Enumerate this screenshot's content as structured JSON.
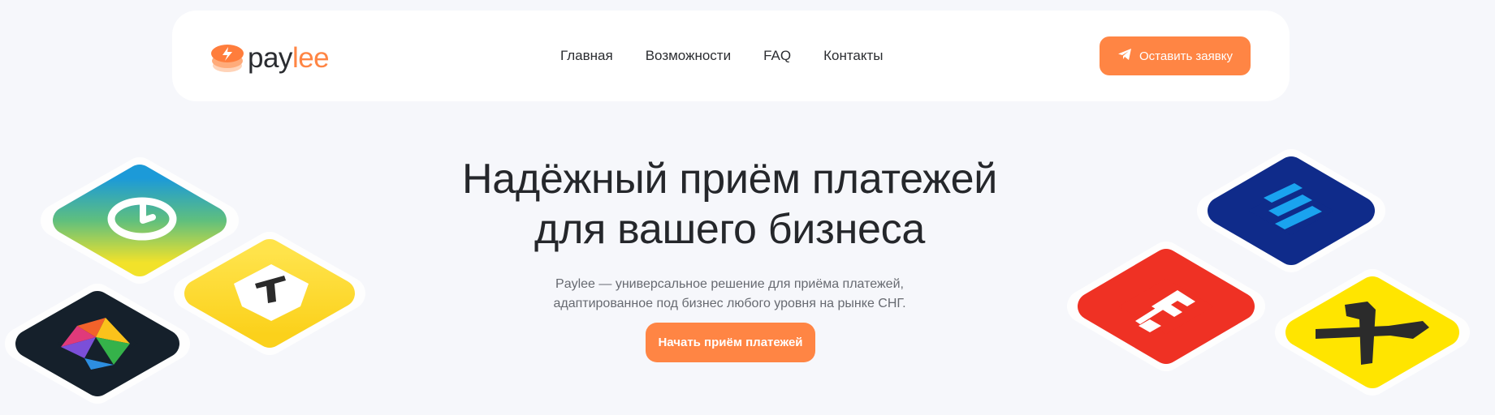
{
  "header": {
    "logo": {
      "part1": "pay",
      "part2": "lee"
    },
    "nav": [
      "Главная",
      "Возможности",
      "FAQ",
      "Контакты"
    ],
    "cta_label": "Оставить заявку"
  },
  "hero": {
    "title_line1": "Надёжный приём платежей",
    "title_line2": "для вашего бизнеса",
    "subtitle_line1": "Paylee — универсальное решение для приёма платежей,",
    "subtitle_line2": "адаптированное под бизнес любого уровня на рынке СНГ.",
    "cta_label": "Начать приём платежей"
  },
  "tiles": [
    {
      "name": "sbp-tile",
      "icon": "check-circle-icon"
    },
    {
      "name": "tbank-tile",
      "icon": "t-shield-icon"
    },
    {
      "name": "multicolor-tile",
      "icon": "colorful-triangles-icon"
    },
    {
      "name": "vtb-tile",
      "icon": "stripes-icon"
    },
    {
      "name": "alfa-tile",
      "icon": "a-letter-icon"
    },
    {
      "name": "yellow-tile",
      "icon": "t-hammer-icon"
    }
  ],
  "colors": {
    "accent": "#ff8544",
    "background": "#f6f7fb",
    "text": "#25272b",
    "muted": "#676a71"
  }
}
